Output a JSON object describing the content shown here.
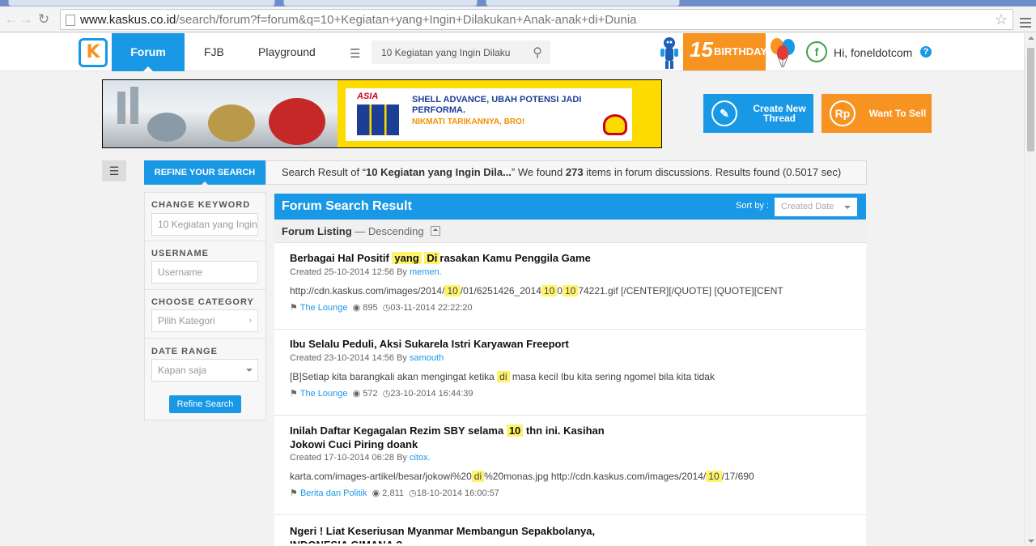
{
  "browser": {
    "url_host": "www.kaskus.co.id",
    "url_path": "/search/forum?f=forum&q=10+Kegiatan+yang+Ingin+Dilakukan+Anak-anak+di+Dunia"
  },
  "header": {
    "logo": "K",
    "tabs": [
      "Forum",
      "FJB",
      "Playground"
    ],
    "search_value": "10 Kegiatan yang Ingin Dilaku",
    "birthday_number": "15",
    "birthday_word": "BIRTHDAY",
    "avatar_letter": "f",
    "greeting": "Hi, foneldotcom",
    "help": "?"
  },
  "banner": {
    "brand": "ASIA",
    "headline": "SHELL ADVANCE, UBAH POTENSI JADI PERFORMA.",
    "subline": "NIKMATI TARIKANNYA, BRO!"
  },
  "actions": {
    "create_label": "Create New Thread",
    "sell_icon": "Rp",
    "sell_label": "Want To Sell"
  },
  "summary": {
    "prefix": "Search Result of “",
    "query": "10 Kegiatan yang Ingin Dila...",
    "mid": "” We found ",
    "count": "273",
    "suffix": " items in forum discussions. Results found (0.5017 sec)"
  },
  "sidebar": {
    "tab": "REFINE YOUR SEARCH",
    "keyword_label": "CHANGE KEYWORD",
    "keyword_value": "10 Kegiatan yang Ingin",
    "username_label": "USERNAME",
    "username_placeholder": "Username",
    "category_label": "CHOOSE CATEGORY",
    "category_value": "Pilih Kategori",
    "date_label": "DATE RANGE",
    "date_value": "Kapan saja",
    "button": "Refine Search"
  },
  "results": {
    "title": "Forum Search Result",
    "sort_label": "Sort by :",
    "sort_value": "Created Date",
    "listing_label": "Forum Listing",
    "listing_order": "— Descending",
    "items": [
      {
        "title_parts": [
          "Berbagai Hal Positif ",
          "yang",
          " ",
          "Di",
          "rasakan Kamu Penggila Game"
        ],
        "created": "Created 25-10-2014 12:56 By ",
        "author": "memen.",
        "snippet_parts": [
          "http://cdn.kaskus.com/images/2014/",
          "10",
          "/01/6251426_2014",
          "10",
          "0",
          "10",
          "74221.gif [/CENTER][/QUOTE] [QUOTE][CENT"
        ],
        "category": "The Lounge",
        "views": "895",
        "last": "03-11-2014 22:22:20"
      },
      {
        "title_parts": [
          "Ibu Selalu Peduli, Aksi Sukarela Istri Karyawan Freeport"
        ],
        "created": "Created 23-10-2014 14:56 By ",
        "author": "samouth",
        "snippet_parts": [
          "[B]Setiap kita barangkali akan mengingat ketika ",
          "di",
          " masa kecil Ibu kita sering ngomel bila kita tidak"
        ],
        "category": "The Lounge",
        "views": "572",
        "last": "23-10-2014 16:44:39"
      },
      {
        "title_parts": [
          "Inilah Daftar Kegagalan Rezim SBY selama ",
          "10",
          " thn ini. Kasihan Jokowi Cuci Piring doank"
        ],
        "created": "Created 17-10-2014 06:28 By ",
        "author": "citox.",
        "snippet_parts": [
          "karta.com/images-artikel/besar/jokowi%20",
          "di",
          "%20monas.jpg http://cdn.kaskus.com/images/2014/",
          "10",
          "/17/690"
        ],
        "category": "Berita dan Politik",
        "views": "2,811",
        "last": "18-10-2014 16:00:57"
      },
      {
        "title_parts": [
          "Ngeri ! Liat Keseriusan Myanmar Membangun Sepakbolanya, INDONESIA GIMANA ?"
        ]
      }
    ]
  },
  "colors": {
    "accent": "#1998e6",
    "orange": "#f79321",
    "highlight": "#fff36b"
  }
}
